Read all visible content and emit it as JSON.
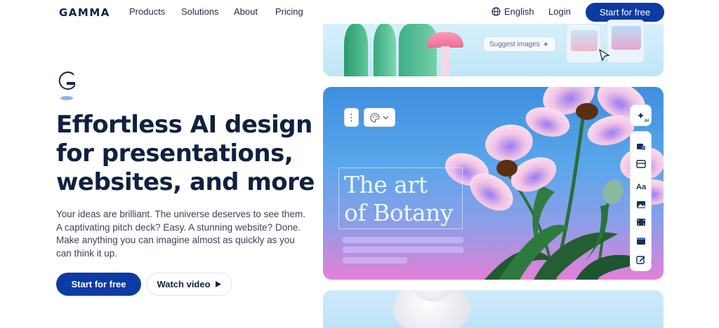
{
  "nav": {
    "logo": "GAMMA",
    "links": [
      "Products",
      "Solutions",
      "About",
      "Pricing"
    ],
    "language": "English",
    "login": "Login",
    "cta": "Start for free"
  },
  "hero": {
    "headline": "Effortless AI design for presentations, websites, and more",
    "subcopy": "Your ideas are brilliant. The universe deserves to see them. A captivating pitch deck? Easy. A stunning website? Done. Make anything you can imagine almost as quickly as you can think it up.",
    "primary_cta": "Start for free",
    "secondary_cta": "Watch video"
  },
  "preview": {
    "suggest_label": "Suggest images",
    "slide_title_line1": "The art",
    "slide_title_line2": "of Botany",
    "ai_badge": "AI",
    "text_tool_label": "Aa"
  },
  "colors": {
    "brand": "#0c3ba3",
    "heading": "#10203f"
  }
}
